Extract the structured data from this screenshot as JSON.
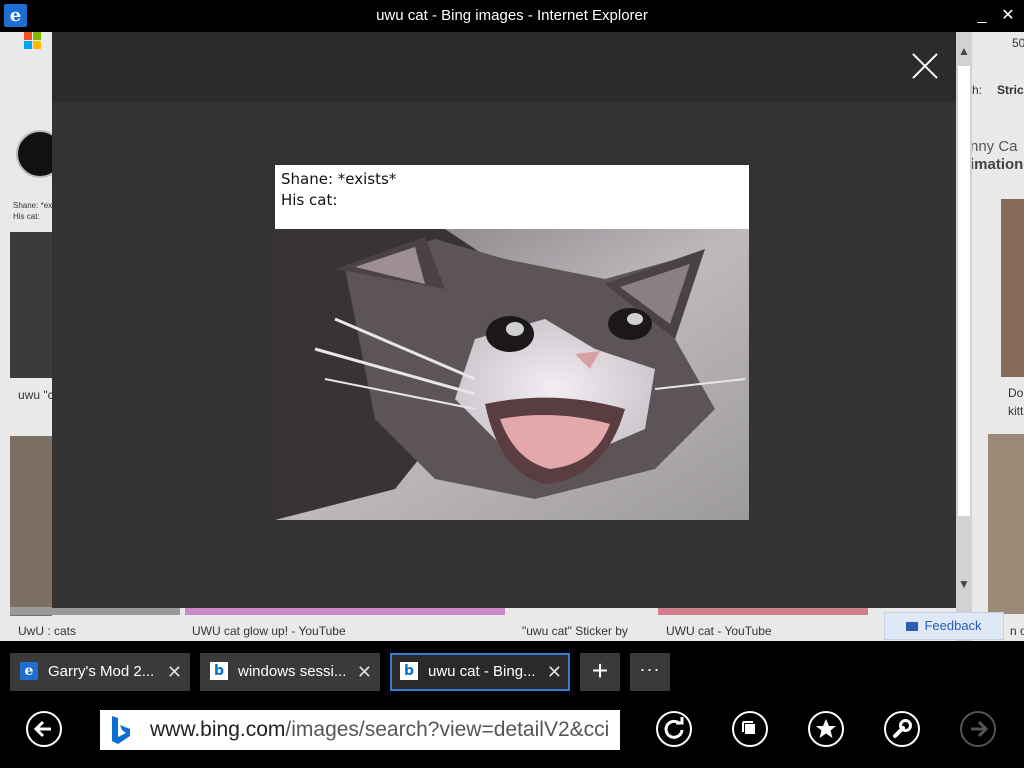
{
  "window": {
    "title": "uwu cat - Bing images - Internet Explorer",
    "minimize": "_",
    "close": "✕"
  },
  "background_page": {
    "captions": [
      "UwU : cats",
      "UWU cat glow up! - YouTube",
      "\"uwu cat\" Sticker by",
      "UWU cat - YouTube",
      "uwu \"c",
      "Do",
      "kitt"
    ],
    "header_right": [
      "50",
      "h:",
      "Stric",
      "nny Ca",
      "imation"
    ],
    "small_text": [
      "Shane: *ex",
      "His cat:"
    ],
    "feedback_label": "Feedback",
    "right_cut_text": "n o"
  },
  "viewer": {
    "caption_line1": "Shane: *exists*",
    "caption_line2": "His cat:"
  },
  "tabs": [
    {
      "label": "Garry's Mod 2...",
      "icon": "ie-icon",
      "active": false
    },
    {
      "label": "windows sessi...",
      "icon": "bing-icon",
      "active": false
    },
    {
      "label": "uwu cat - Bing...",
      "icon": "bing-icon",
      "active": true
    }
  ],
  "tab_actions": {
    "add": "+",
    "more": "···"
  },
  "address_bar": {
    "domain": "www.bing.com",
    "path": "/images/search?view=detailV2&cci"
  },
  "colors": {
    "accent": "#2f7fd7",
    "bing": "#0a6fd1"
  }
}
